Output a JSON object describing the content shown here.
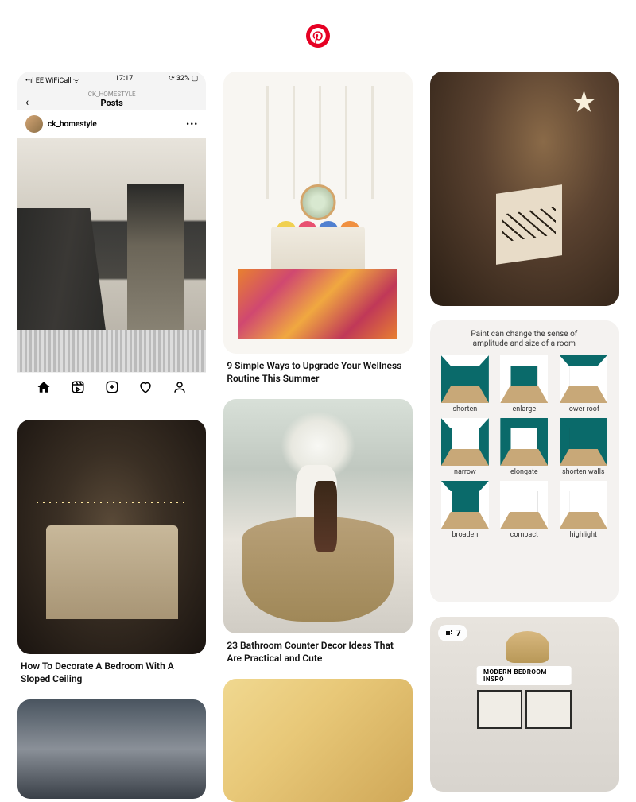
{
  "brand": {
    "name": "Pinterest",
    "color": "#e60023"
  },
  "pins": {
    "col1": {
      "p1": {
        "ig": {
          "status_left": "••ıl EE WiFiCall ᯤ",
          "status_time": "17:17",
          "status_right": "⟳ 32% ▢",
          "back": "‹",
          "subtitle": "CK_HOMESTYLE",
          "title": "Posts",
          "username": "ck_homestyle",
          "more": "•••"
        }
      },
      "p2": {
        "title": "How To Decorate A Bedroom With A Sloped Ceiling"
      }
    },
    "col2": {
      "p4": {
        "title": "9 Simple Ways to Upgrade Your Wellness Routine This Summer"
      },
      "p5": {
        "title": "23 Bathroom Counter Decor Ideas That Are Practical and Cute"
      }
    },
    "col3": {
      "p8": {
        "heading": "Paint can change the sense of amplitude and size of a room",
        "labels": {
          "a": "shorten",
          "b": "enlarge",
          "c": "lower roof",
          "d": "narrow",
          "e": "elongate",
          "f": "shorten walls",
          "g": "broaden",
          "h": "compact",
          "i": "highlight"
        }
      },
      "p9": {
        "badge_count": "7",
        "overlay": "MODERN BEDROOM INSPO"
      }
    }
  }
}
